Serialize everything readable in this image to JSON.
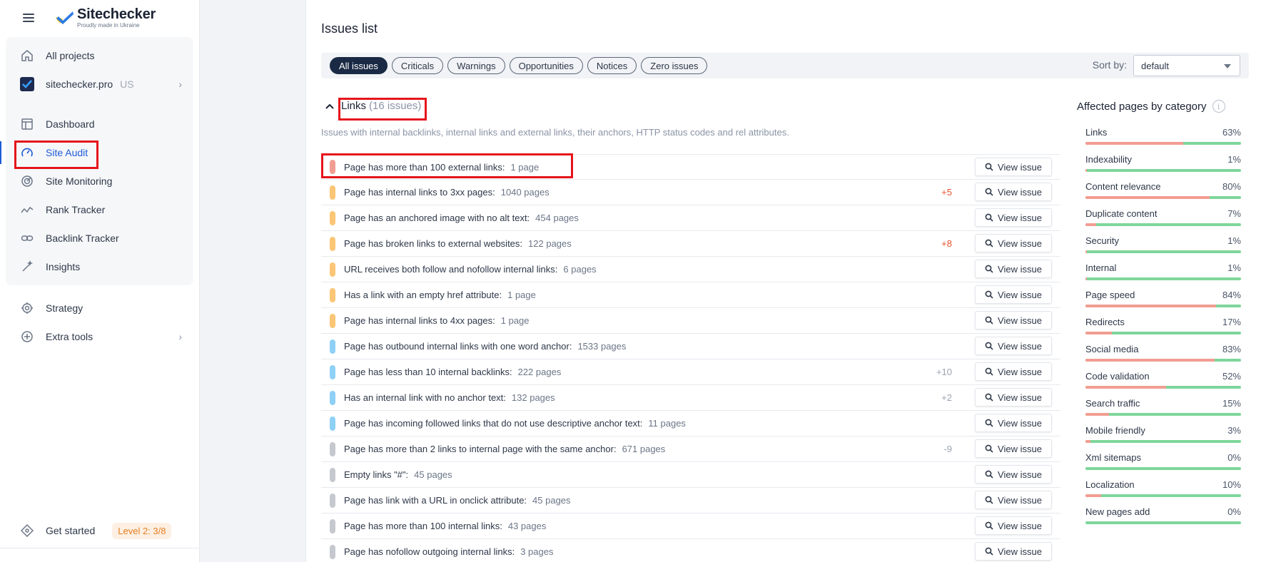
{
  "sidebar": {
    "logo_name": "Sitechecker",
    "logo_sub": "Proudly made in Ukraine",
    "all_projects": "All projects",
    "site": "sitechecker.pro",
    "region": "US",
    "nav": [
      "Dashboard",
      "Site Audit",
      "Site Monitoring",
      "Rank Tracker",
      "Backlink Tracker",
      "Insights"
    ],
    "strategy": "Strategy",
    "extra_tools": "Extra tools",
    "get_started": "Get started",
    "level": "Level 2: 3/8"
  },
  "main": {
    "title": "Issues list",
    "filters": [
      "All issues",
      "Criticals",
      "Warnings",
      "Opportunities",
      "Notices",
      "Zero issues"
    ],
    "sort_label": "Sort by:",
    "sort_value": "default",
    "category": "Links",
    "category_count": "(16 issues)",
    "category_desc": "Issues with internal backlinks, internal links and external links, their anchors, HTTP status codes and rel attributes.",
    "view_label": "View issue",
    "issues": [
      {
        "title": "Page has more than 100 external links:",
        "count": "1 page",
        "delta": "",
        "sev": "critical"
      },
      {
        "title": "Page has internal links to 3xx pages:",
        "count": "1040 pages",
        "delta": "+5",
        "sev": "warning"
      },
      {
        "title": "Page has an anchored image with no alt text:",
        "count": "454 pages",
        "delta": "",
        "sev": "warning"
      },
      {
        "title": "Page has broken links to external websites:",
        "count": "122 pages",
        "delta": "+8",
        "sev": "warning"
      },
      {
        "title": "URL receives both follow and nofollow internal links:",
        "count": "6 pages",
        "delta": "",
        "sev": "warning"
      },
      {
        "title": "Has a link with an empty href attribute:",
        "count": "1 page",
        "delta": "",
        "sev": "warning"
      },
      {
        "title": "Page has internal links to 4xx pages:",
        "count": "1 page",
        "delta": "",
        "sev": "warning"
      },
      {
        "title": "Page has outbound internal links with one word anchor:",
        "count": "1533 pages",
        "delta": "",
        "sev": "opportunity"
      },
      {
        "title": "Page has less than 10 internal backlinks:",
        "count": "222 pages",
        "delta": "+10",
        "sev": "opportunity"
      },
      {
        "title": "Has an internal link with no anchor text:",
        "count": "132 pages",
        "delta": "+2",
        "sev": "opportunity"
      },
      {
        "title": "Page has incoming followed links that do not use descriptive anchor text:",
        "count": "11 pages",
        "delta": "",
        "sev": "opportunity"
      },
      {
        "title": "Page has more than 2 links to internal page with the same anchor:",
        "count": "671 pages",
        "delta": "-9",
        "sev": "notice"
      },
      {
        "title": "Empty links \"#\":",
        "count": "45 pages",
        "delta": "",
        "sev": "notice"
      },
      {
        "title": "Page has link with a URL in onclick attribute:",
        "count": "45 pages",
        "delta": "",
        "sev": "notice"
      },
      {
        "title": "Page has more than 100 internal links:",
        "count": "43 pages",
        "delta": "",
        "sev": "notice"
      },
      {
        "title": "Page has nofollow outgoing internal links:",
        "count": "3 pages",
        "delta": "",
        "sev": "notice"
      }
    ]
  },
  "affected": {
    "title": "Affected pages by category",
    "items": [
      {
        "name": "Links",
        "pct": "63%",
        "value": 63
      },
      {
        "name": "Indexability",
        "pct": "1%",
        "value": 1
      },
      {
        "name": "Content relevance",
        "pct": "80%",
        "value": 80
      },
      {
        "name": "Duplicate content",
        "pct": "7%",
        "value": 7
      },
      {
        "name": "Security",
        "pct": "1%",
        "value": 1
      },
      {
        "name": "Internal",
        "pct": "1%",
        "value": 1
      },
      {
        "name": "Page speed",
        "pct": "84%",
        "value": 84
      },
      {
        "name": "Redirects",
        "pct": "17%",
        "value": 17
      },
      {
        "name": "Social media",
        "pct": "83%",
        "value": 83
      },
      {
        "name": "Code validation",
        "pct": "52%",
        "value": 52
      },
      {
        "name": "Search traffic",
        "pct": "15%",
        "value": 15
      },
      {
        "name": "Mobile friendly",
        "pct": "3%",
        "value": 3
      },
      {
        "name": "Xml sitemaps",
        "pct": "0%",
        "value": 0
      },
      {
        "name": "Localization",
        "pct": "10%",
        "value": 10
      },
      {
        "name": "New pages add",
        "pct": "0%",
        "value": 0
      }
    ]
  },
  "colors": {
    "critical": "#f29d92",
    "warning": "#fbc675",
    "opportunity": "#8fd0f6",
    "notice": "#c5c9cf",
    "delta_up": "#e8512f",
    "delta_neutral": "#9aa3b0",
    "accent": "#1e5bd6",
    "highlight": "#e5141b"
  }
}
